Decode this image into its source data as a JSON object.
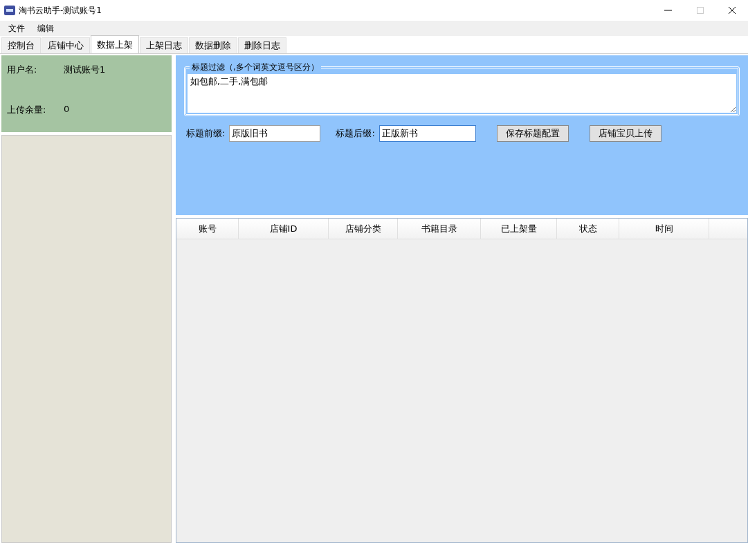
{
  "window": {
    "title": "淘书云助手-测试账号1"
  },
  "menu": [
    "文件",
    "编辑"
  ],
  "tabs": [
    {
      "label": "控制台",
      "selected": false
    },
    {
      "label": "店铺中心",
      "selected": false
    },
    {
      "label": "数据上架",
      "selected": true
    },
    {
      "label": "上架日志",
      "selected": false
    },
    {
      "label": "数据删除",
      "selected": false
    },
    {
      "label": "删除日志",
      "selected": false
    }
  ],
  "user_panel": {
    "username_label": "用户名:",
    "username": "测试账号1",
    "quota_label": "上传余量:",
    "quota": "0"
  },
  "filter": {
    "legend": "标题过滤（,多个词英文逗号区分）",
    "value": "如包邮,二手,满包邮"
  },
  "prefix": {
    "label": "标题前缀:",
    "value": "原版旧书"
  },
  "suffix": {
    "label": "标题后缀:",
    "value": "正版新书"
  },
  "buttons": [
    "保存标题配置",
    "店铺宝贝上传"
  ],
  "table": {
    "columns": [
      "账号",
      "店铺ID",
      "店铺分类",
      "书籍目录",
      "已上架量",
      "状态",
      "时间"
    ]
  }
}
